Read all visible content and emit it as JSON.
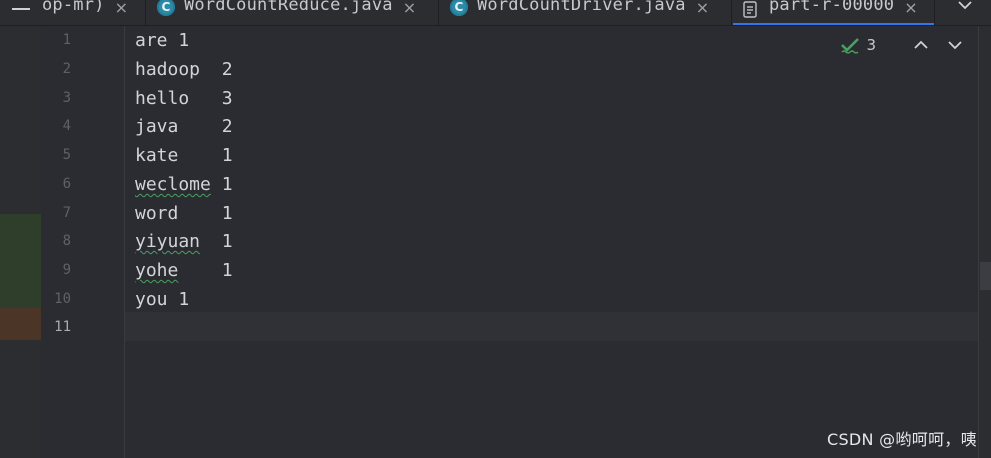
{
  "tabs": [
    {
      "label": "op-mr)",
      "icon": "none",
      "active": false
    },
    {
      "label": "WordCountReduce.java",
      "icon": "java-class-icon",
      "active": false
    },
    {
      "label": "WordCountDriver.java",
      "icon": "java-class-icon",
      "active": false
    },
    {
      "label": "part-r-00000",
      "icon": "text-file-icon",
      "active": true
    }
  ],
  "tab_java_icon_letter": "C",
  "tab_close_glyph": "×",
  "editor": {
    "lines": [
      {
        "num": "1",
        "text": "are 1"
      },
      {
        "num": "2",
        "text": "hadoop  2"
      },
      {
        "num": "3",
        "text": "hello   3"
      },
      {
        "num": "4",
        "text": "java    2"
      },
      {
        "num": "5",
        "text": "kate    1"
      },
      {
        "num": "6",
        "word": "weclome",
        "rest": " 1"
      },
      {
        "num": "7",
        "text": "word    1"
      },
      {
        "num": "8",
        "word": "yiyuan",
        "rest": "  1"
      },
      {
        "num": "9",
        "word": "yohe",
        "rest": "    1"
      },
      {
        "num": "10",
        "text": "you 1"
      },
      {
        "num": "11",
        "text": ""
      }
    ],
    "current_line": "11"
  },
  "inspections": {
    "count": "3",
    "icon": "check-icon",
    "accent_color": "#4aa060"
  },
  "watermark": "CSDN @哟呵呵，咦",
  "colors": {
    "active_tab_underline": "#3574f0",
    "java_icon_bg": "#2e8ba8",
    "typo_underline": "#4aa060"
  }
}
